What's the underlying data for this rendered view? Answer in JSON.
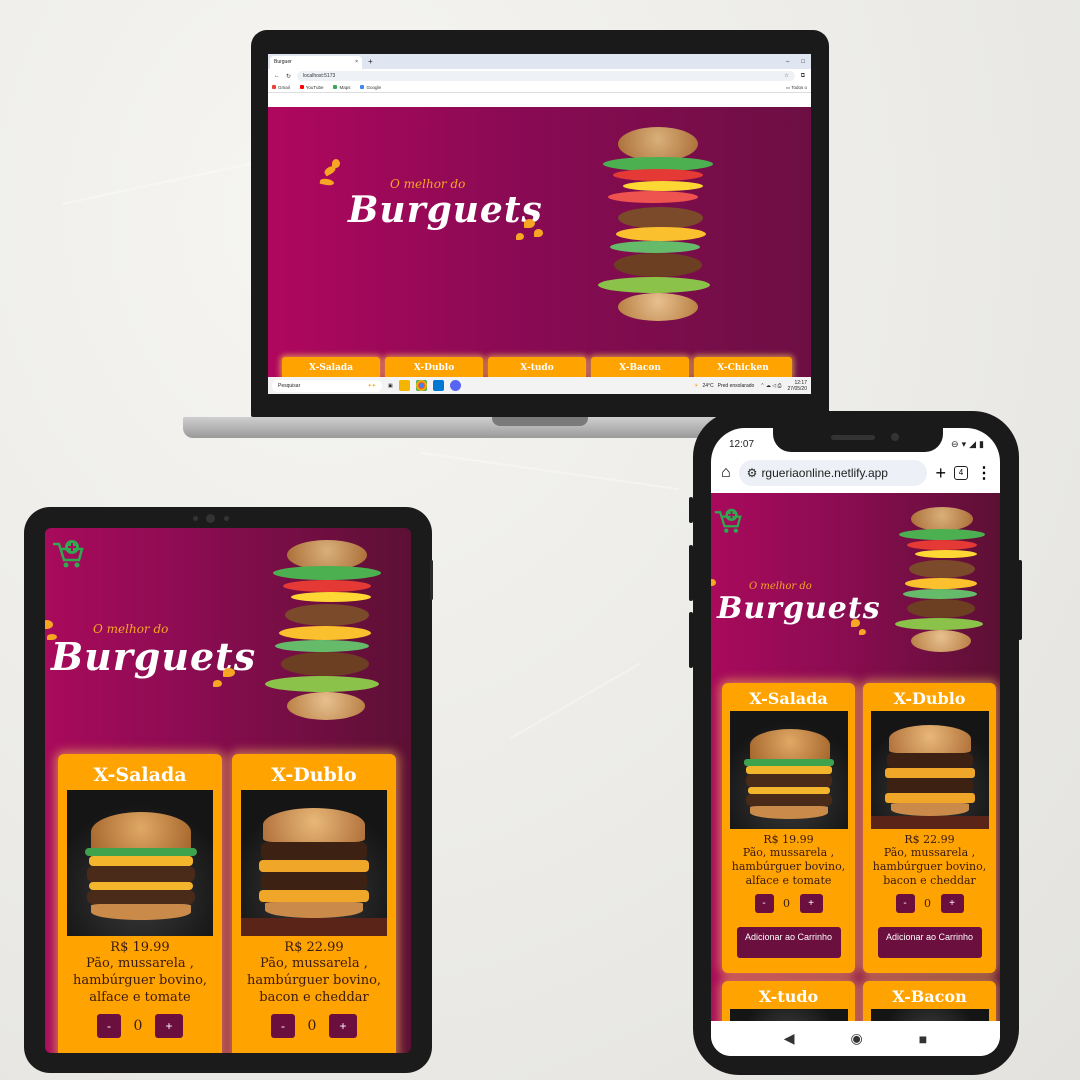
{
  "laptop": {
    "tab_title": "Burguer",
    "tab_close": "×",
    "new_tab": "+",
    "win_min": "–",
    "win_max": "□",
    "url": "localhost:5173",
    "bookmarks": [
      "Gmail",
      "YouTube",
      "Maps",
      "Google"
    ],
    "bookmarks_right": "Todos o",
    "taskbar_search": "Pesquisar",
    "weather_temp": "24°C",
    "weather_text": "Pred ensolarado",
    "clock_time": "12:17",
    "clock_date": "27/05/20",
    "categories": [
      "X-Salada",
      "X-Dublo",
      "X-tudo",
      "X-Bacon",
      "X-Chicken"
    ]
  },
  "brand": {
    "tagline": "O melhor do",
    "name": "Burguets"
  },
  "products": [
    {
      "name": "X-Salada",
      "price": "R$ 19.99",
      "desc": "Pão, mussarela , hambúrguer bovino, alface e tomate"
    },
    {
      "name": "X-Dublo",
      "price": "R$ 22.99",
      "desc": "Pão, mussarela , hambúrguer bovino, bacon e cheddar"
    },
    {
      "name": "X-tudo"
    },
    {
      "name": "X-Bacon"
    }
  ],
  "qty": {
    "minus": "-",
    "plus": "+",
    "value": "0"
  },
  "add_to_cart": "Adicionar ao Carrinho",
  "phone": {
    "time": "12:07",
    "url": "rgueriaonline.netlify.app",
    "tab_count": "4",
    "home": "⌂",
    "new_tab": "+",
    "more": "⋮",
    "nav_back": "◀",
    "nav_home": "◉",
    "nav_recent": "■"
  },
  "colors": {
    "brand_magenta": "#a90a5c",
    "card_orange": "#ffa300",
    "button_wine": "#6b0f3f",
    "logo_orange": "#f6a623"
  }
}
